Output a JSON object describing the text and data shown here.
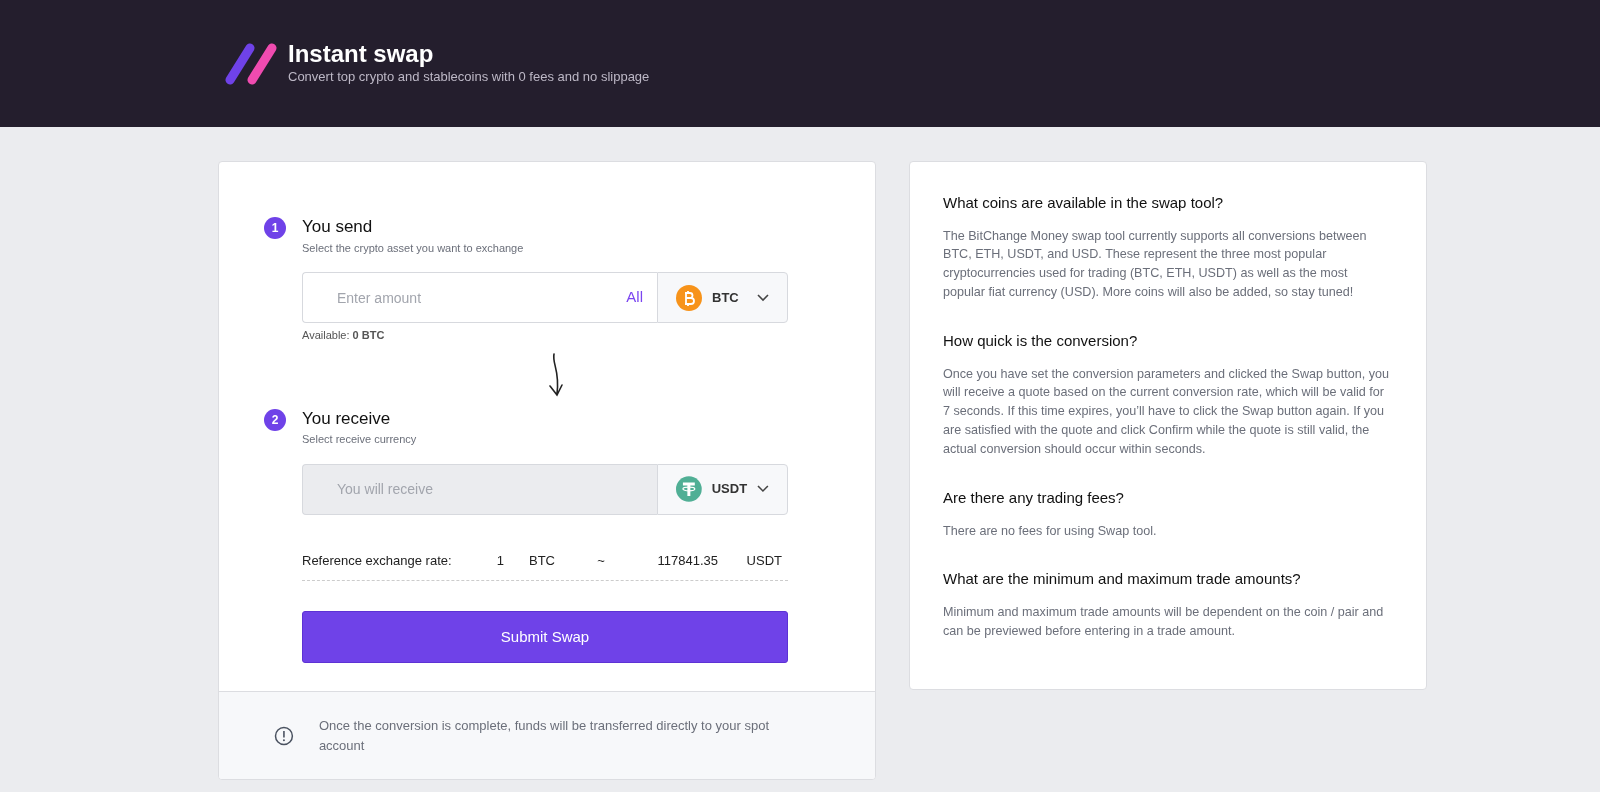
{
  "header": {
    "title": "Instant swap",
    "subtitle": "Convert top crypto and stablecoins with 0 fees and no slippage"
  },
  "steps": [
    {
      "number": "1",
      "title": "You send",
      "subtitle": "Select the crypto asset you want to exchange",
      "field": {
        "placeholder": "Enter amount",
        "disabled": false
      },
      "max_link": "All",
      "currency": {
        "code": "BTC",
        "kind": "btc"
      },
      "note": "Available: **0 BTC**"
    },
    {
      "number": "2",
      "title": "You receive",
      "subtitle": "Select receive currency",
      "field": {
        "placeholder": "You will receive",
        "disabled": true
      },
      "currency": {
        "code": "USDT",
        "kind": "usdt"
      }
    }
  ],
  "rate": {
    "label": "Reference exchange rate:",
    "amount": "1",
    "from": "BTC",
    "separator": "~",
    "value": "117841.35",
    "to": "USDT"
  },
  "submit": "Submit Swap",
  "notice": "Once the conversion is complete, funds will be transferred directly to your spot account",
  "faq": [
    {
      "question": "What coins are available in the swap tool?",
      "answer": "The BitChange Money swap tool currently supports all conversions between BTC, ETH, USDT, and USD. These represent the three most popular cryptocurrencies used for trading (BTC, ETH, USDT) as well as the most popular fiat currency (USD). More coins will also be added, so stay tuned!"
    },
    {
      "question": "How quick is the conversion?",
      "answer": "Once you have set the conversion parameters and clicked the Swap button, you will receive a quote based on the current conversion rate, which will be valid for 7 seconds. If this time expires, you’ll have to click the Swap button again. If you are satisfied with the quote and click Confirm while the quote is still valid, the actual conversion should occur within seconds."
    },
    {
      "question": "Are there any trading fees?",
      "answer": "There are no fees for using Swap tool."
    },
    {
      "question": "What are the minimum and maximum trade amounts?",
      "answer": "Minimum and maximum trade amounts will be dependent on the coin / pair and can be previewed before entering in a trade amount."
    }
  ]
}
